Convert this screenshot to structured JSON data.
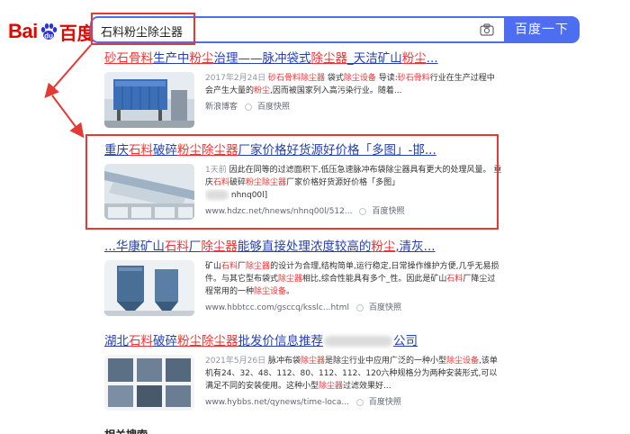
{
  "logo": {
    "text_left": "Bai",
    "text_right": "百度"
  },
  "search": {
    "query": "石料粉尘除尘器",
    "button_label": "百度一下"
  },
  "icons": {
    "camera": "camera-icon",
    "snapshot_dot": "circle-dot-icon"
  },
  "colors": {
    "brand_red": "#e10601",
    "accent_blue": "#4e6ef2",
    "highlight_red": "#f73131",
    "link_blue": "#2440b3",
    "annotation_red": "#e53935"
  },
  "results": [
    {
      "title_parts": [
        {
          "t": "砂石骨料",
          "em": true
        },
        {
          "t": "生产中",
          "em": false
        },
        {
          "t": "粉尘",
          "em": true
        },
        {
          "t": "治理——脉冲袋式",
          "em": false
        },
        {
          "t": "除尘器",
          "em": true
        },
        {
          "t": "_天洁矿山",
          "em": false
        },
        {
          "t": "粉尘",
          "em": true
        },
        {
          "t": "...",
          "em": false
        }
      ],
      "abstract_parts": [
        {
          "t": "2017年2月24日 ",
          "em": false,
          "date": true
        },
        {
          "t": "砂石骨料除尘器",
          "em": true
        },
        {
          "t": " 袋式",
          "em": false
        },
        {
          "t": "除尘设备",
          "em": true
        },
        {
          "t": " 导读:",
          "em": false
        },
        {
          "t": "砂石骨料",
          "em": true
        },
        {
          "t": "行业在生产过程中会产生大量的",
          "em": false
        },
        {
          "t": "粉尘",
          "em": true
        },
        {
          "t": ",因而被国家列入高污染行业。随着...",
          "em": false
        }
      ],
      "source": "新浪博客",
      "snapshot": "百度快照"
    },
    {
      "title_parts": [
        {
          "t": "重庆",
          "em": false
        },
        {
          "t": "石料",
          "em": true
        },
        {
          "t": "破碎",
          "em": false
        },
        {
          "t": "粉尘除尘器",
          "em": true
        },
        {
          "t": "厂家价格好货源好价格「多图」-邯...",
          "em": false
        }
      ],
      "abstract_parts": [
        {
          "t": "1天前 ",
          "em": false,
          "date": true
        },
        {
          "t": "因此在同等的过滤面积下,低压急速脉冲布袋除尘器具有更大的处理风量。 重庆",
          "em": false
        },
        {
          "t": "石料",
          "em": true
        },
        {
          "t": "破碎",
          "em": false
        },
        {
          "t": "粉尘除尘器",
          "em": true
        },
        {
          "t": "厂家价格好货源好价格「多图」",
          "em": false
        }
      ],
      "abstract_tail": "nhnq00l]",
      "url": "www.hdzc.net/hnews/nhnq00l/512...",
      "snapshot": "百度快照"
    },
    {
      "title_parts": [
        {
          "t": "...华康矿山",
          "em": false
        },
        {
          "t": "石料",
          "em": true
        },
        {
          "t": "厂",
          "em": false
        },
        {
          "t": "除尘器",
          "em": true
        },
        {
          "t": "能够直接处理浓度较高的",
          "em": false
        },
        {
          "t": "粉尘",
          "em": true
        },
        {
          "t": ",清灰...",
          "em": false
        }
      ],
      "abstract_parts": [
        {
          "t": "矿山",
          "em": false
        },
        {
          "t": "石料",
          "em": true
        },
        {
          "t": "厂",
          "em": false
        },
        {
          "t": "除尘器",
          "em": true
        },
        {
          "t": "的设计为合理,结构简单,运行稳定,日常操作维护方便,几乎无易损件。与其它型布袋式",
          "em": false
        },
        {
          "t": "除尘器",
          "em": true
        },
        {
          "t": "相比,综合性能具有多个_性。因此是矿山",
          "em": false
        },
        {
          "t": "石料",
          "em": true
        },
        {
          "t": "厂降尘过程常用的一种",
          "em": false
        },
        {
          "t": "除尘设备",
          "em": true
        },
        {
          "t": "。",
          "em": false
        }
      ],
      "url": "www.hbbtcc.com/gsccq/ksslc...html",
      "snapshot": "百度快照"
    },
    {
      "title_parts": [
        {
          "t": "湖北",
          "em": false
        },
        {
          "t": "石料",
          "em": true
        },
        {
          "t": "破碎",
          "em": false
        },
        {
          "t": "粉尘除尘器",
          "em": true
        },
        {
          "t": "批发价信息推荐",
          "em": false
        }
      ],
      "title_tail": "公司",
      "abstract_parts": [
        {
          "t": "2021年5月26日 ",
          "em": false,
          "date": true
        },
        {
          "t": "脉冲布袋",
          "em": false
        },
        {
          "t": "除尘器",
          "em": true
        },
        {
          "t": "是除尘行业中应用广泛的一种小型",
          "em": false
        },
        {
          "t": "除尘设备",
          "em": true
        },
        {
          "t": ",该单机有24、32、48、112、80、112、112、120六种规格分为两种安装形式,可以满足不同的安装使用。这种小型",
          "em": false
        },
        {
          "t": "除尘器",
          "em": true
        },
        {
          "t": "过滤效果好...",
          "em": false
        }
      ],
      "url": "www.hybbs.net/qynews/time-loca...",
      "snapshot": "百度快照"
    }
  ],
  "related": "相关搜索"
}
